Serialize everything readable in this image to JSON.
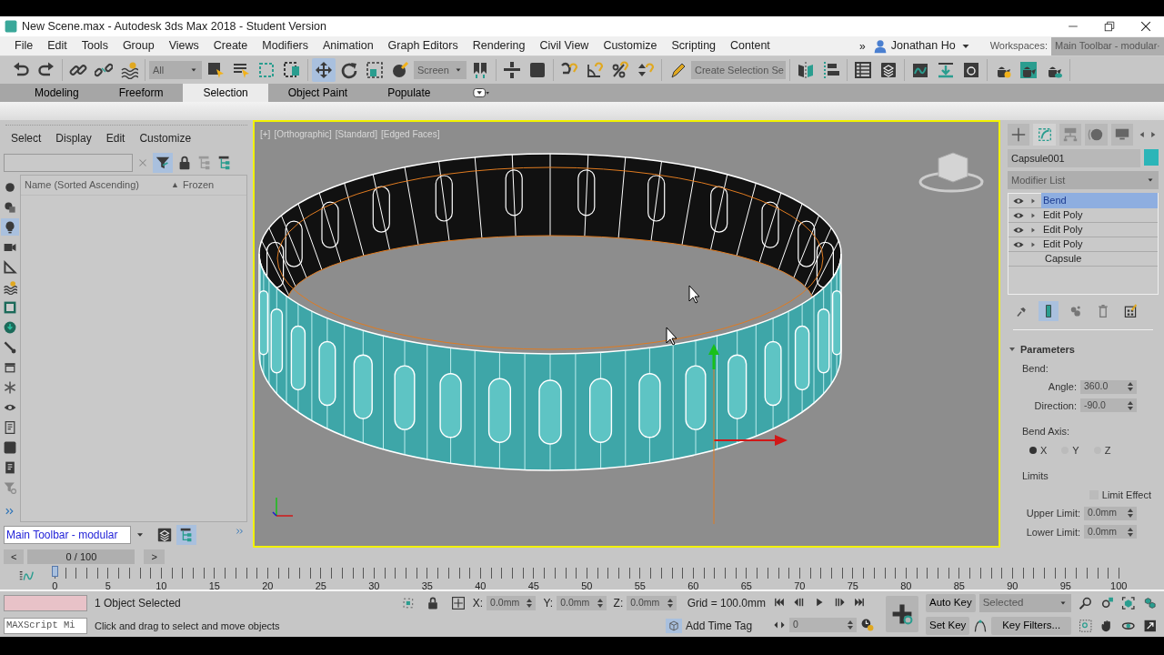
{
  "window": {
    "title": "New Scene.max - Autodesk 3ds Max 2018 - Student Version"
  },
  "menu": {
    "items": [
      "File",
      "Edit",
      "Tools",
      "Group",
      "Views",
      "Create",
      "Modifiers",
      "Animation",
      "Graph Editors",
      "Rendering",
      "Civil View",
      "Customize",
      "Scripting",
      "Content"
    ],
    "overflow": "»",
    "user": "Jonathan Ho",
    "workspaces_label": "Workspaces:",
    "workspace": "Main Toolbar - modular"
  },
  "toolbar": {
    "groups": [
      [
        {
          "kind": "undo",
          "selected": false
        },
        {
          "kind": "redo",
          "selected": false
        }
      ],
      [
        {
          "kind": "link",
          "selected": false
        },
        {
          "kind": "unlink",
          "selected": false
        },
        {
          "kind": "wave",
          "selected": false
        }
      ],
      [
        {
          "kind": "dropdown",
          "value": "All"
        },
        {
          "kind": "selobj",
          "selected": false
        },
        {
          "kind": "selname",
          "selected": false
        },
        {
          "kind": "rect",
          "selected": false
        },
        {
          "kind": "window",
          "selected": false
        }
      ],
      [
        {
          "kind": "move",
          "selected": true
        },
        {
          "kind": "rotate",
          "selected": false
        },
        {
          "kind": "scale",
          "selected": false
        },
        {
          "kind": "place",
          "selected": false
        },
        {
          "kind": "dropdown",
          "value": "Screen"
        },
        {
          "kind": "pivot",
          "selected": false
        }
      ],
      [
        {
          "kind": "manip",
          "selected": false
        },
        {
          "kind": "keyb",
          "selected": false
        }
      ],
      [
        {
          "kind": "snap",
          "selected": false
        },
        {
          "kind": "angle",
          "selected": false
        },
        {
          "kind": "percent",
          "selected": false
        },
        {
          "kind": "spinner",
          "selected": false
        }
      ],
      [
        {
          "kind": "pencil",
          "selected": false
        },
        {
          "kind": "dropdown",
          "value": "Create Selection Se"
        }
      ],
      [
        {
          "kind": "mirror",
          "selected": false
        },
        {
          "kind": "align",
          "selected": false
        }
      ],
      [
        {
          "kind": "table",
          "selected": false
        },
        {
          "kind": "layers",
          "selected": false
        }
      ],
      [
        {
          "kind": "curve",
          "selected": false
        },
        {
          "kind": "download",
          "selected": false
        },
        {
          "kind": "schem",
          "selected": false
        }
      ],
      [
        {
          "kind": "teagear",
          "selected": false
        },
        {
          "kind": "teaframe",
          "selected": false
        },
        {
          "kind": "teacloud",
          "selected": false
        }
      ]
    ]
  },
  "ribbon": {
    "tabs": [
      {
        "label": "Modeling",
        "selected": false
      },
      {
        "label": "Freeform",
        "selected": false
      },
      {
        "label": "Selection",
        "selected": true
      },
      {
        "label": "Object Paint",
        "selected": false
      },
      {
        "label": "Populate",
        "selected": false
      }
    ]
  },
  "scene_explorer": {
    "tabs": [
      "Select",
      "Display",
      "Edit",
      "Customize"
    ],
    "filters": [
      {
        "kind": "sphere",
        "selected": false
      },
      {
        "kind": "shapes",
        "selected": false
      },
      {
        "kind": "bulb",
        "selected": true
      },
      {
        "kind": "camera",
        "selected": false
      },
      {
        "kind": "helper",
        "selected": false
      },
      {
        "kind": "wave",
        "selected": false
      },
      {
        "kind": "frame",
        "selected": false
      },
      {
        "kind": "dlc",
        "selected": false
      },
      {
        "kind": "brush",
        "selected": false
      },
      {
        "kind": "container",
        "selected": false
      },
      {
        "kind": "snow",
        "selected": false
      },
      {
        "kind": "eye",
        "selected": false
      },
      {
        "kind": "doc",
        "selected": false
      },
      {
        "kind": "keyb",
        "selected": false
      },
      {
        "kind": "docd",
        "selected": false
      },
      {
        "kind": "funnel",
        "selected": false
      }
    ],
    "columns": [
      {
        "label": "Name (Sorted Ascending)",
        "sort_mark": "▲"
      },
      {
        "label": "Frozen"
      }
    ],
    "workspace": "Main Toolbar - modular"
  },
  "viewport": {
    "labels": [
      "[+]",
      "[Orthographic]",
      "[Standard]",
      "[Edged Faces]"
    ],
    "active": true
  },
  "command_panel": {
    "tabs": [
      {
        "kind": "plus",
        "selected": false
      },
      {
        "kind": "modify",
        "selected": true
      },
      {
        "kind": "hierp",
        "selected": false
      },
      {
        "kind": "disc",
        "selected": false
      },
      {
        "kind": "monitor",
        "selected": false
      }
    ],
    "object": {
      "name": "Capsule001",
      "color": "#2bb5b8"
    },
    "modifier_list": "Modifier List",
    "stack": [
      {
        "label": "Bend",
        "kind": "modifier",
        "selected": true
      },
      {
        "label": "Edit Poly",
        "kind": "modifier",
        "selected": false
      },
      {
        "label": "Edit Poly",
        "kind": "modifier",
        "selected": false
      },
      {
        "label": "Edit Poly",
        "kind": "modifier",
        "selected": false
      },
      {
        "label": "Capsule",
        "kind": "base",
        "selected": false
      }
    ],
    "stack_tools": [
      {
        "kind": "pin",
        "selected": false
      },
      {
        "kind": "bar",
        "selected": true
      },
      {
        "kind": "dots",
        "selected": false
      },
      {
        "kind": "trash",
        "selected": false
      },
      {
        "kind": "config",
        "selected": false
      }
    ],
    "rollout": {
      "title": "Parameters",
      "expanded": true,
      "bend_label": "Bend:",
      "angle": {
        "label": "Angle:",
        "value": "360.0"
      },
      "direction": {
        "label": "Direction:",
        "value": "-90.0"
      },
      "axis_label": "Bend Axis:",
      "axes": [
        {
          "label": "X",
          "selected": true
        },
        {
          "label": "Y",
          "selected": false
        },
        {
          "label": "Z",
          "selected": false
        }
      ],
      "limits_label": "Limits",
      "limit_effect": {
        "label": "Limit Effect",
        "checked": false
      },
      "upper": {
        "label": "Upper Limit:",
        "value": "0.0mm"
      },
      "lower": {
        "label": "Lower Limit:",
        "value": "0.0mm"
      }
    }
  },
  "time_slider": {
    "prev": "<",
    "label": "0 / 100",
    "next": ">",
    "level": 0
  },
  "ruler": {
    "labels": [
      "0",
      "5",
      "10",
      "15",
      "20",
      "25",
      "30",
      "35",
      "40",
      "45",
      "50",
      "55",
      "60",
      "65",
      "70",
      "75",
      "80",
      "85",
      "90",
      "95",
      "100"
    ]
  },
  "status": {
    "maxscript": "MAXScript Mi",
    "selection": "1 Object Selected",
    "prompt": "Click and drag to select and move objects",
    "coords": [
      {
        "label": "X:",
        "value": "0.0mm"
      },
      {
        "label": "Y:",
        "value": "0.0mm"
      },
      {
        "label": "Z:",
        "value": "0.0mm"
      }
    ],
    "grid": "Grid = 100.0mm",
    "time_tag": "Add Time Tag",
    "frame": "0",
    "auto_key": "Auto Key",
    "key_set": "Selected",
    "set_key": "Set Key",
    "key_filters": "Key Filters..."
  }
}
